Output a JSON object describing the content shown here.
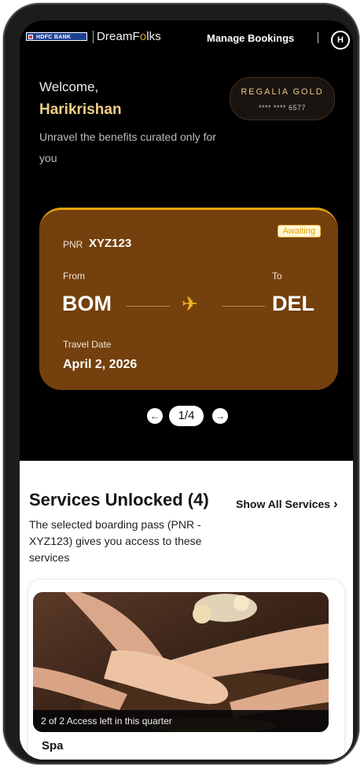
{
  "header": {
    "bank_logo": "HDFC BANK",
    "brand_prefix": "DreamF",
    "brand_o": "o",
    "brand_suffix": "lks",
    "manage_bookings": "Manage Bookings",
    "avatar_initial": "H"
  },
  "welcome": {
    "greeting": "Welcome,",
    "name": "Harikrishan",
    "tagline": "Unravel the benefits curated only for you"
  },
  "card": {
    "tier": "REGALIA GOLD",
    "masked_number": "**** **** 6577"
  },
  "booking": {
    "status": "Awaiting",
    "pnr_label": "PNR",
    "pnr": "XYZ123",
    "from_label": "From",
    "from_code": "BOM",
    "to_label": "To",
    "to_code": "DEL",
    "plane_icon": "✈",
    "travel_date_label": "Travel Date",
    "travel_date": "April 2, 2026"
  },
  "pager": {
    "prev": "←",
    "next": "→",
    "current": "1/4"
  },
  "services": {
    "title": "Services Unlocked (4)",
    "show_all": "Show All Services",
    "show_all_chevron": "›",
    "description": "The selected boarding pass (PNR - XYZ123) gives you access to these services",
    "items": [
      {
        "access_text": "2 of 2 Access left in this quarter",
        "name": "Spa"
      }
    ]
  },
  "colors": {
    "ticket_bg": "#74400d",
    "ticket_border": "#e4a30c",
    "accent_gold": "#f1cf85"
  }
}
